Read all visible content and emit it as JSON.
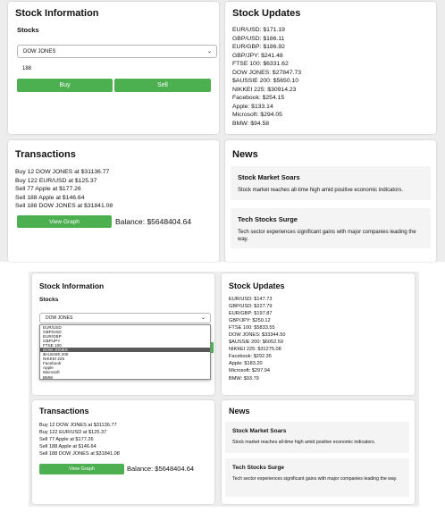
{
  "screen1": {
    "stock_info": {
      "title": "Stock Information",
      "stocks_label": "Stocks",
      "selected_stock": "DOW JONES",
      "quantity": "188",
      "buy_label": "Buy",
      "sell_label": "Sell"
    },
    "stock_updates": {
      "title": "Stock Updates",
      "lines": [
        "EUR/USD: $171.19",
        "GBP/USD: $186.11",
        "EUR/GBP: $186.92",
        "GBP/JPY: $241.48",
        "FTSE 100: $6331.62",
        "DOW JONES: $27847.73",
        "$AUSSIE 200: $5650.10",
        "NIKKEI 225: $30914.23",
        "Facebook: $254.15",
        "Apple: $133.14",
        "Microsoft: $294.05",
        "BMW: $94.58"
      ]
    },
    "transactions": {
      "title": "Transactions",
      "lines": [
        "Buy 12 DOW JONES at $31136.77",
        "Buy 122 EUR/USD at $125.37",
        "Sell 77 Apple at $177.26",
        "Sell 188 Apple at $146.64",
        "Sell 188 DOW JONES at $31841.08"
      ],
      "view_graph_label": "View Graph",
      "balance": "Balance: $5648404.64"
    },
    "news": {
      "title": "News",
      "items": [
        {
          "title": "Stock Market Soars",
          "text": "Stock market reaches all-time high amid positive economic indicators."
        },
        {
          "title": "Tech Stocks Surge",
          "text": "Tech sector experiences significant gains with major companies leading the way."
        }
      ]
    }
  },
  "screen2": {
    "stock_info": {
      "title": "Stock Information",
      "stocks_label": "Stocks",
      "selected_stock": "DOW JONES",
      "dropdown_options": [
        "EUR/USD",
        "GBP/USD",
        "EUR/GBP",
        "GBP/JPY",
        "FTSE 100",
        "DOW JONES",
        "$AUSSIE 200",
        "NIKKEI 225",
        "Facebook",
        "Apple",
        "Microsoft",
        "BMW"
      ],
      "highlighted_option": "DOW JONES"
    },
    "stock_updates": {
      "title": "Stock Updates",
      "lines": [
        "EUR/USD: $147.73",
        "GBP/USD: $227.79",
        "EUR/GBP: $197.87",
        "GBP/JPY: $250.12",
        "FTSE 100: $5833.55",
        "DOW JONES: $33344.50",
        "$AUSSIE 200: $6052.59",
        "NIKKEI 225: $31275.08",
        "Facebook: $292.35",
        "Apple: $183.20",
        "Microsoft: $297.94",
        "BMW: $93.79"
      ]
    },
    "transactions": {
      "title": "Transactions",
      "lines": [
        "Buy 12 DOW JONES at $31136.77",
        "Buy 122 EUR/USD at $125.37",
        "Sell 77 Apple at $177.26",
        "Sell 188 Apple at $146.64",
        "Sell 188 DOW JONES at $31841.08"
      ],
      "view_graph_label": "View Graph",
      "balance": "Balance: $5648404.64"
    },
    "news": {
      "title": "News",
      "items": [
        {
          "title": "Stock Market Soars",
          "text": "Stock market reaches all-time high amid positive economic indicators."
        },
        {
          "title": "Tech Stocks Surge",
          "text": "Tech sector experiences significant gains with major companies leading the way."
        }
      ]
    }
  }
}
